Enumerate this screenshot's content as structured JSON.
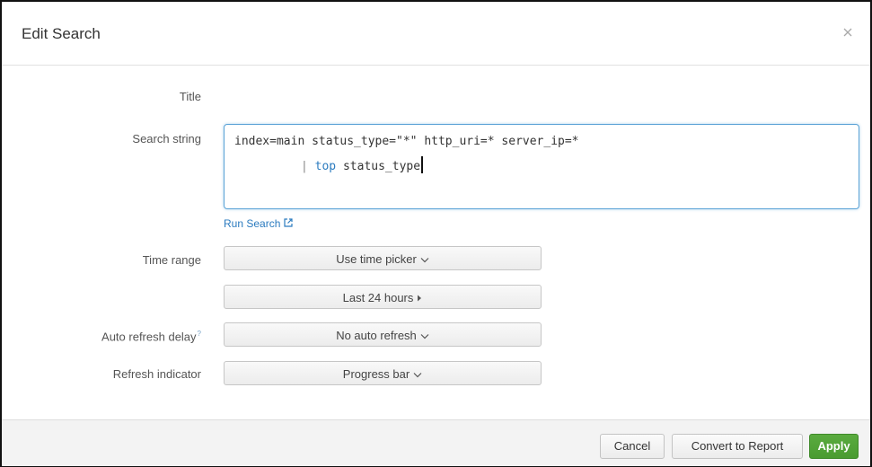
{
  "dialog": {
    "title": "Edit Search"
  },
  "form": {
    "title_label": "Title",
    "search_label": "Search string",
    "search_line1": "index=main status_type=\"*\" http_uri=* server_ip=*",
    "search_pipe": "|",
    "search_keyword": "top",
    "search_rest": "status_type",
    "run_search": "Run Search",
    "time_range_label": "Time range",
    "time_picker": "Use time picker",
    "time_value": "Last 24 hours",
    "auto_refresh_label": "Auto refresh delay",
    "help_mark": "?",
    "auto_refresh_value": "No auto refresh",
    "refresh_indicator_label": "Refresh indicator",
    "refresh_indicator_value": "Progress bar"
  },
  "footer": {
    "cancel": "Cancel",
    "convert": "Convert to Report",
    "apply": "Apply"
  },
  "colors": {
    "link": "#2b7bbf",
    "apply": "#53a33a",
    "focus_border": "#5ba3d6"
  }
}
